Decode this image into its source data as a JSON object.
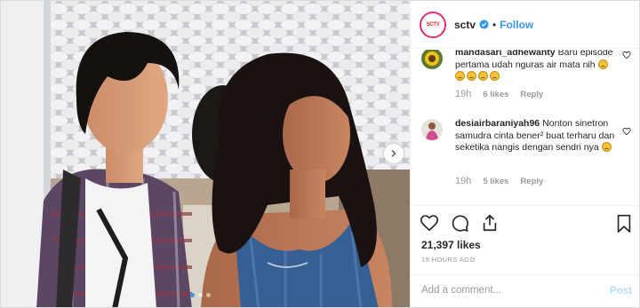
{
  "post": {
    "username": "sctv",
    "avatar_text": "SCTV",
    "separator": "•",
    "follow_label": "Follow",
    "accent_color": "#3897f0",
    "likes": "21,397 likes",
    "time_ago": "19 HOURS AGO",
    "carousel": {
      "slides": 3,
      "active": 1
    }
  },
  "comments": [
    {
      "username": "mandasari_adhewanty",
      "text": "Baru episode pertama udah nguras air mata nih",
      "emoji_count": 5,
      "time": "19h",
      "likes": "6 likes",
      "reply_label": "Reply"
    },
    {
      "username": "desiairbaraniyah96",
      "text": "Nonton sinetron samudra cinta bener² buat terharu dan seketika nangis dengan sendri nya",
      "emoji_count": 1,
      "time": "19h",
      "likes": "5 likes",
      "reply_label": "Reply"
    }
  ],
  "add_comment": {
    "placeholder": "Add a comment...",
    "post_label": "Post"
  },
  "icons": {
    "like": "heart-icon",
    "comment": "comment-icon",
    "share": "share-icon",
    "save": "bookmark-icon",
    "verified": "verified-badge-icon",
    "next": "chevron-right-icon"
  }
}
